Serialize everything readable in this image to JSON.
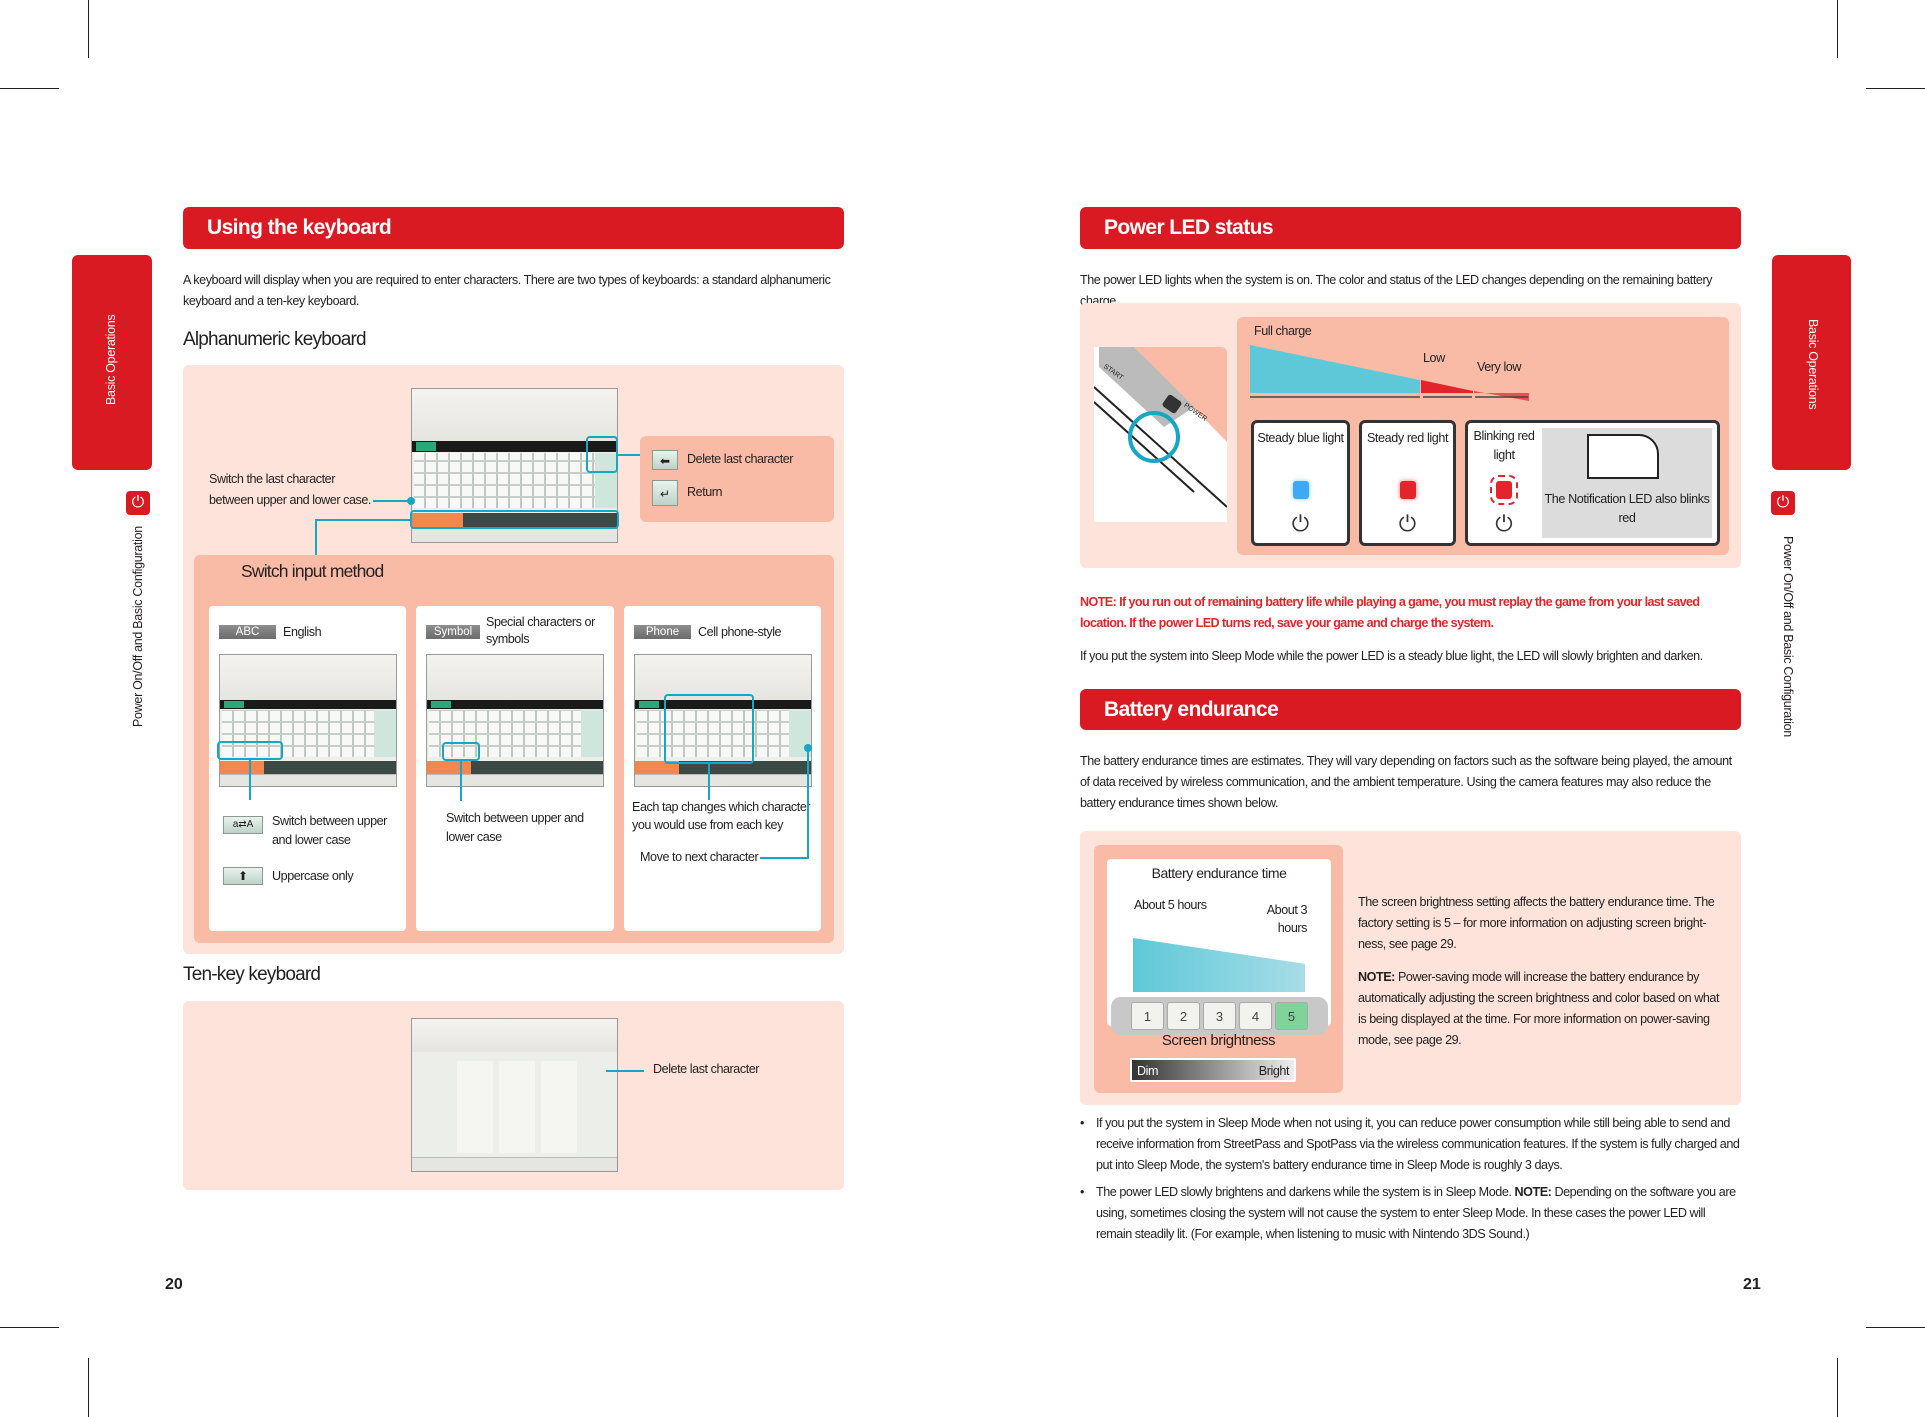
{
  "left_page": {
    "side_tab": {
      "label": "Basic Operations",
      "section": "Power On/Off and Basic Configuration",
      "icon": "power-icon"
    },
    "header": "Using the keyboard",
    "intro": "A keyboard will display when you are required to enter characters. There are two types of keyboards: a standard alphanumeric keyboard and a ten-key keyboard.",
    "alphanumeric": {
      "title": "Alphanumeric keyboard",
      "switch_case_label": "Switch the last character between upper and lower case.",
      "delete_label": "Delete last character",
      "return_label": "Return",
      "switch_input": {
        "title": "Switch input method",
        "cards": [
          {
            "chip": "ABC",
            "label": "English",
            "notes": [
              {
                "icon": "case-toggle-icon",
                "text": "Switch between upper and lower case"
              },
              {
                "icon": "arrow-up-icon",
                "text": "Uppercase only"
              }
            ]
          },
          {
            "chip": "Symbol",
            "label": "Special characters or symbols",
            "note": "Switch between upper and lower case"
          },
          {
            "chip": "Phone",
            "label": "Cell phone-style",
            "note": "Each tap changes which character you would use from each key",
            "note2": "Move to next character"
          }
        ]
      }
    },
    "tenkey": {
      "title": "Ten-key keyboard",
      "delete_label": "Delete last character"
    },
    "page_number": "20"
  },
  "right_page": {
    "side_tab": {
      "label": "Basic Operations",
      "section": "Power On/Off and Basic Configuration",
      "icon": "power-icon"
    },
    "power_led": {
      "header": "Power LED status",
      "intro": "The power LED lights when the system is on. The color and status of the LED changes depending on the remaining battery charge.",
      "levels": {
        "full": "Full charge",
        "low": "Low",
        "very_low": "Very low"
      },
      "states": [
        {
          "label": "Steady blue light",
          "color": "#3fa9f5"
        },
        {
          "label": "Steady red light",
          "color": "#e3242b"
        },
        {
          "label": "Blinking red light",
          "color": "#e3242b"
        }
      ],
      "notification": "The Notification LED also blinks red",
      "device_labels": {
        "start": "START",
        "power": "POWER"
      },
      "note": "NOTE: If you run out of remaining battery life while playing a game, you must replay the game from your last saved location. If the power LED turns red, save your game and charge the system.",
      "sleep": "If you put the system into Sleep Mode while the power LED is a steady blue light, the LED will slowly brighten and darken."
    },
    "battery": {
      "header": "Battery endurance",
      "intro": "The battery endurance times are estimates. They will vary depending on factors such as the software being played, the amount of data received by wireless communication, and the ambient temperature. Using the camera features may also reduce the battery endurance times shown below.",
      "chart_title": "Battery endurance time",
      "max_label": "About 5 hours",
      "min_label": "About 3 hours",
      "levels": [
        "1",
        "2",
        "3",
        "4",
        "5"
      ],
      "selected_level": "5",
      "brightness_title": "Screen brightness",
      "dim": "Dim",
      "bright": "Bright",
      "side_text": "The screen brightness setting affects the battery endurance time. The factory setting is 5 – for more information on adjusting screen bright-ness, see page 29.",
      "side_note_bold": "NOTE:",
      "side_note": " Power-saving mode will increase the battery endurance by automatically adjusting the screen brightness and color based on what is being displayed at the time. For more information on power-saving mode, see page 29.",
      "bullets": [
        {
          "text": "If you put the system in Sleep Mode when not using it, you can reduce power consumption while still being able to send and receive information from StreetPass and SpotPass via the wireless communication features. If the system is fully charged and put into Sleep Mode, the system's battery endurance time in Sleep Mode is roughly 3 days."
        },
        {
          "pre": "The power LED slowly brightens and darkens while the system is in Sleep Mode. ",
          "bold": "NOTE:",
          "post": " Depending on the software you are using, sometimes closing the system will not cause the system to enter Sleep Mode. In these cases the power LED will remain steadily lit. (For example, when listening to music with Nintendo 3DS Sound.)"
        }
      ]
    },
    "page_number": "21"
  },
  "colors": {
    "accent": "#da1a22",
    "panel": "#fde3da",
    "panel_dark": "#f9bba6",
    "callout": "#17a6c4",
    "charge_blue": "#5ec8d8"
  }
}
